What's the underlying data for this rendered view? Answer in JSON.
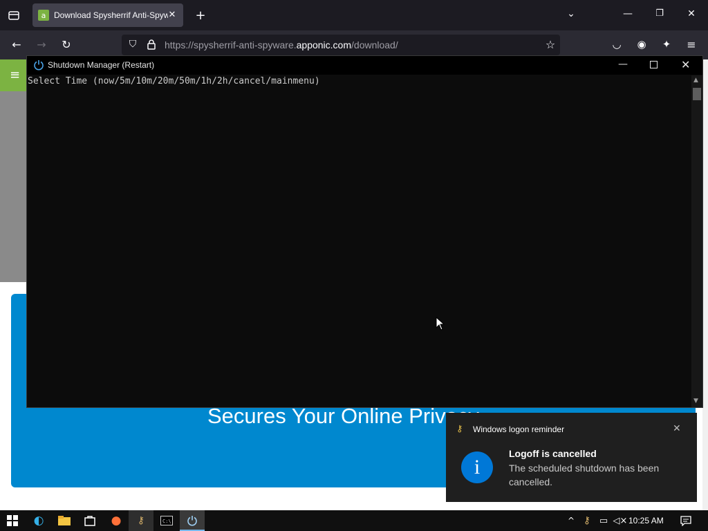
{
  "browser": {
    "tab_title": "Download Spysherrif Anti-Spyware",
    "tab_favicon": "a",
    "url_prefix": "https://spysherrif-anti-spyware.",
    "url_domain": "apponic.com",
    "url_path": "/download/"
  },
  "page": {
    "heading": "Secures Your Online Privacy",
    "accent_green": "#7cb342",
    "accent_blue": "#0088cf"
  },
  "console": {
    "title": "Shutdown Manager (Restart)",
    "prompt": "Select Time (now/5m/10m/20m/50m/1h/2h/cancel/mainmenu)"
  },
  "toast": {
    "app_name": "Windows logon reminder",
    "title": "Logoff is cancelled",
    "body": "The scheduled shutdown has been cancelled.",
    "info_glyph": "i"
  },
  "taskbar": {
    "time": "10:25 AM"
  }
}
